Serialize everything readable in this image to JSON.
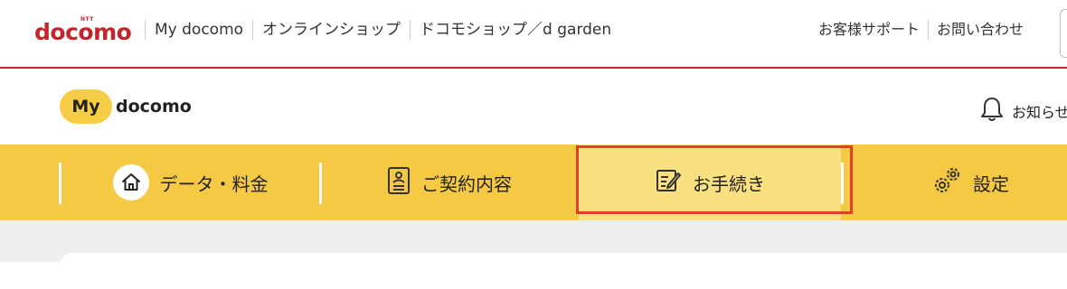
{
  "header": {
    "brand_small": "NTT",
    "brand": "docomo",
    "links": [
      "My docomo",
      "オンラインショップ",
      "ドコモショップ／d garden"
    ],
    "right_links": [
      "お客様サポート",
      "お問い合わせ"
    ]
  },
  "mydocomo": {
    "logo_badge": "My",
    "logo_word": "docomo",
    "notice_label": "お知らせ"
  },
  "nav": {
    "items": [
      {
        "label": "データ・料金",
        "icon": "home-icon"
      },
      {
        "label": "ご契約内容",
        "icon": "contract-document-icon"
      },
      {
        "label": "お手続き",
        "icon": "edit-note-icon",
        "active": true
      },
      {
        "label": "設定",
        "icon": "gears-icon"
      }
    ]
  },
  "colors": {
    "brand_red": "#c0272d",
    "nav_yellow": "#f5c944",
    "active_yellow": "#fae07f",
    "highlight_red": "#e0402b",
    "background_gray": "#efeff2"
  }
}
